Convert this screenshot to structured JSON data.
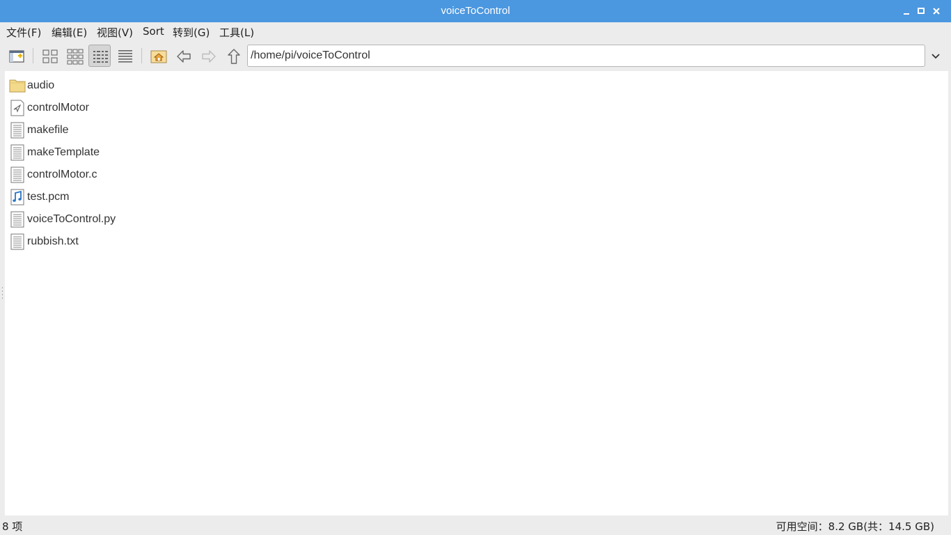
{
  "window": {
    "title": "voiceToControl"
  },
  "menu": [
    {
      "label": "文件(F)"
    },
    {
      "label": "编辑(E)"
    },
    {
      "label": "视图(V)"
    },
    {
      "label": "Sort"
    },
    {
      "label": "转到(G)"
    },
    {
      "label": "工具(L)"
    }
  ],
  "toolbar": {
    "buttons": [
      {
        "name": "new-window-icon"
      },
      {
        "name": "icon-view-icon"
      },
      {
        "name": "thumbnail-view-icon"
      },
      {
        "name": "compact-view-icon",
        "active": true
      },
      {
        "name": "detailed-list-view-icon"
      },
      {
        "name": "home-icon"
      },
      {
        "name": "back-arrow-icon"
      },
      {
        "name": "forward-arrow-icon"
      },
      {
        "name": "up-arrow-icon"
      },
      {
        "name": "chevron-down-icon"
      }
    ],
    "path": "/home/pi/voiceToControl"
  },
  "files": [
    {
      "name": "audio",
      "icon": "folder-icon"
    },
    {
      "name": "controlMotor",
      "icon": "executable-icon"
    },
    {
      "name": "makefile",
      "icon": "text-file-icon"
    },
    {
      "name": "makeTemplate",
      "icon": "text-file-icon"
    },
    {
      "name": "controlMotor.c",
      "icon": "text-file-icon"
    },
    {
      "name": "test.pcm",
      "icon": "audio-file-icon"
    },
    {
      "name": "voiceToControl.py",
      "icon": "text-file-icon"
    },
    {
      "name": "rubbish.txt",
      "icon": "text-file-icon"
    }
  ],
  "status": {
    "count": "8 项",
    "free_space": "可用空间：8.2 GB(共：14.5 GB)"
  },
  "colors": {
    "titlebar": "#4b97e0",
    "folder": "#f3d98a",
    "home": "#e6a540"
  }
}
